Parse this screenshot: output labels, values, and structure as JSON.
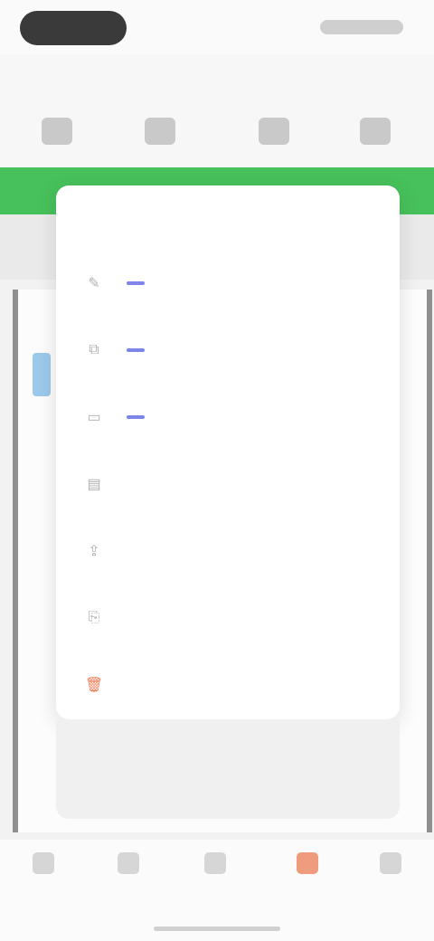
{
  "appbar": {
    "title": "",
    "action": ""
  },
  "toolbar": {
    "icons": [
      "undo-icon",
      "format-icon",
      "insert-icon",
      "more-icon"
    ]
  },
  "menu": {
    "header": "",
    "items": [
      {
        "label": "",
        "icon": "pencil-icon",
        "badge": ""
      },
      {
        "label": "",
        "icon": "copy-icon",
        "badge": ""
      },
      {
        "label": "",
        "icon": "folder-icon",
        "badge": ""
      },
      {
        "label": "",
        "icon": "clipboard-icon",
        "badge": ""
      },
      {
        "label": "",
        "icon": "share-icon",
        "badge": ""
      },
      {
        "label": "",
        "icon": "export-icon",
        "badge": ""
      },
      {
        "label": "",
        "icon": "delete-icon",
        "badge": "",
        "color": "#f07c55"
      }
    ]
  },
  "tabs": [
    {
      "label": "",
      "icon": "home-icon"
    },
    {
      "label": "",
      "icon": "files-icon"
    },
    {
      "label": "",
      "icon": "apps-icon"
    },
    {
      "label": "",
      "icon": "tools-icon",
      "active": true
    },
    {
      "label": "",
      "icon": "me-icon"
    }
  ],
  "colors": {
    "accent_green": "#47c15b",
    "badge": "#7d85e8",
    "danger": "#f07c55"
  }
}
